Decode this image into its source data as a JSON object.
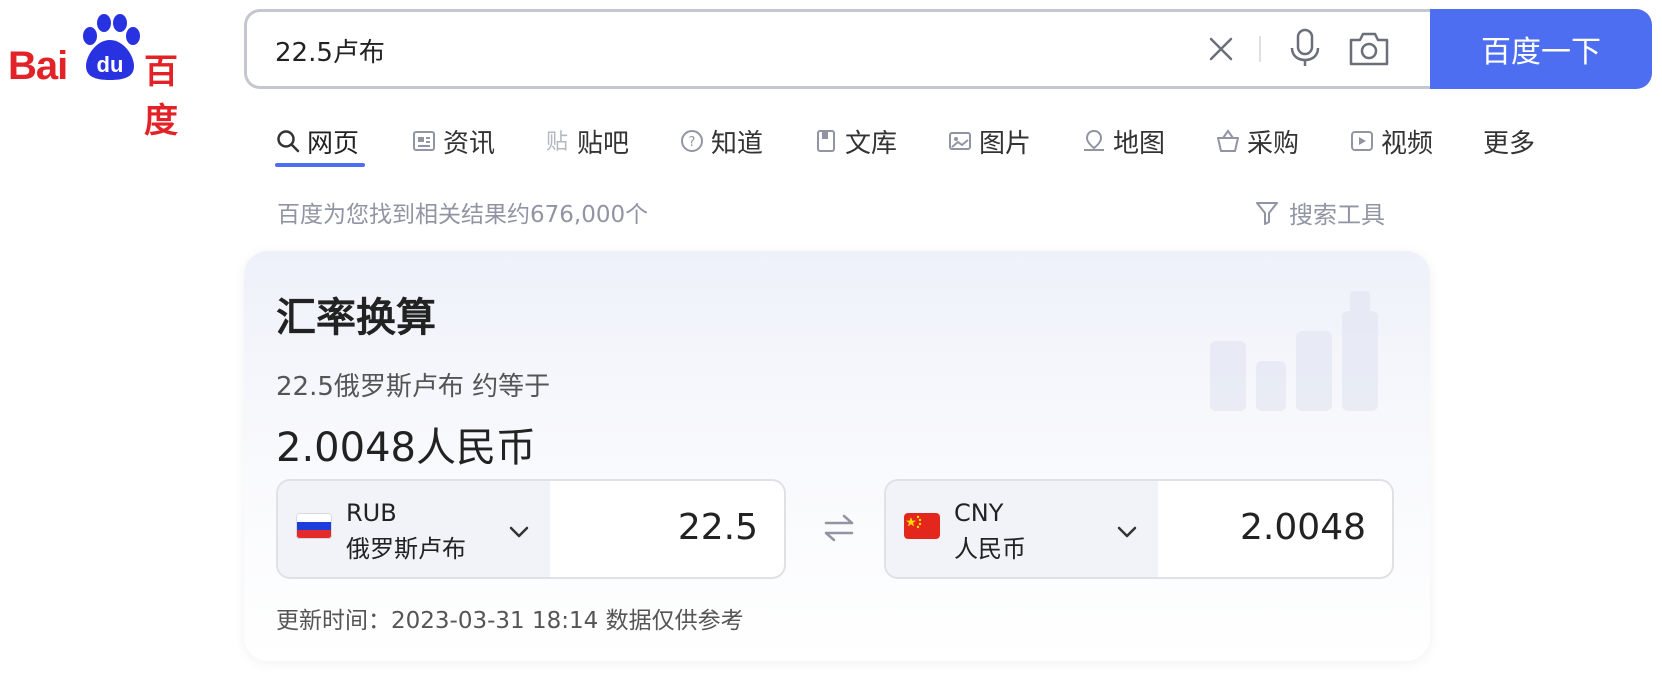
{
  "logo": {
    "text_left": "Bai",
    "text_paw": "du",
    "text_right": "百度"
  },
  "search": {
    "query": "22.5卢布",
    "button_label": "百度一下"
  },
  "tabs": [
    {
      "label": "网页",
      "icon": "search-icon",
      "active": true
    },
    {
      "label": "资讯",
      "icon": "news-icon"
    },
    {
      "label": "贴吧",
      "icon": "tieba-icon"
    },
    {
      "label": "知道",
      "icon": "question-icon"
    },
    {
      "label": "文库",
      "icon": "document-icon"
    },
    {
      "label": "图片",
      "icon": "image-icon"
    },
    {
      "label": "地图",
      "icon": "map-icon"
    },
    {
      "label": "采购",
      "icon": "basket-icon"
    },
    {
      "label": "视频",
      "icon": "video-icon"
    },
    {
      "label": "更多",
      "icon": ""
    }
  ],
  "result_count": "百度为您找到相关结果约676,000个",
  "search_tools_label": "搜索工具",
  "card": {
    "title": "汇率换算",
    "from_line": "22.5俄罗斯卢布 约等于",
    "result_line": "2.0048人民币",
    "from": {
      "code": "RUB",
      "name": "俄罗斯卢布",
      "amount": "22.5"
    },
    "to": {
      "code": "CNY",
      "name": "人民币",
      "amount": "2.0048"
    },
    "update_note": "更新时间：2023-03-31 18:14 数据仅供参考"
  },
  "colors": {
    "brand_blue": "#4e6ef2",
    "logo_red": "#e32227",
    "logo_blue": "#2932e1"
  }
}
